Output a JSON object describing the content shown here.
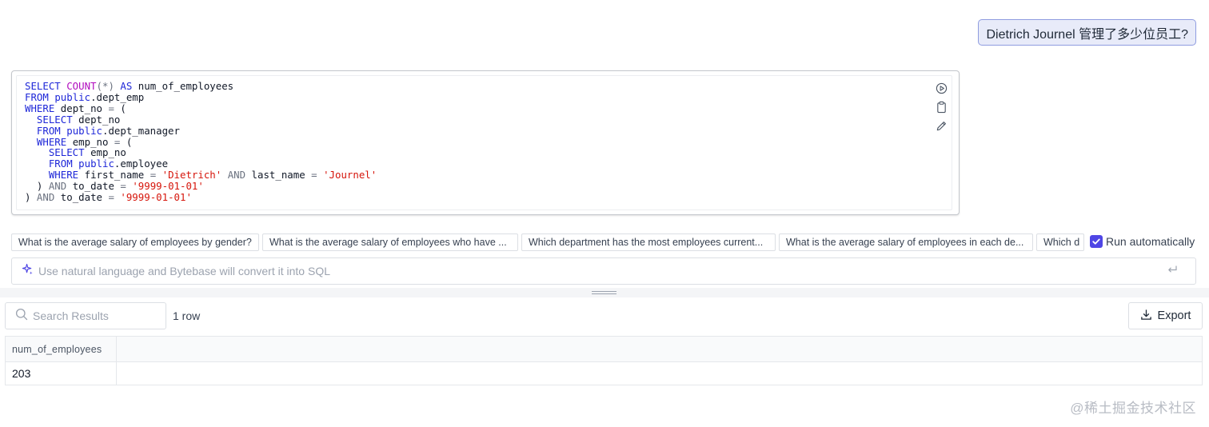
{
  "question": "Dietrich Journel 管理了多少位员工?",
  "sql": {
    "lines": [
      [
        {
          "t": "kw",
          "v": "SELECT "
        },
        {
          "t": "fn",
          "v": "COUNT"
        },
        {
          "t": "op",
          "v": "(*)"
        },
        {
          "t": "tx",
          "v": " "
        },
        {
          "t": "kw",
          "v": "AS"
        },
        {
          "t": "tx",
          "v": " num_of_employees"
        }
      ],
      [
        {
          "t": "kw",
          "v": "FROM "
        },
        {
          "t": "kw",
          "v": "public"
        },
        {
          "t": "tx",
          "v": ".dept_emp"
        }
      ],
      [
        {
          "t": "kw",
          "v": "WHERE"
        },
        {
          "t": "tx",
          "v": " dept_no "
        },
        {
          "t": "op",
          "v": "="
        },
        {
          "t": "tx",
          "v": " ("
        }
      ],
      [
        {
          "t": "tx",
          "v": "  "
        },
        {
          "t": "kw",
          "v": "SELECT"
        },
        {
          "t": "tx",
          "v": " dept_no"
        }
      ],
      [
        {
          "t": "tx",
          "v": "  "
        },
        {
          "t": "kw",
          "v": "FROM "
        },
        {
          "t": "kw",
          "v": "public"
        },
        {
          "t": "tx",
          "v": ".dept_manager"
        }
      ],
      [
        {
          "t": "tx",
          "v": "  "
        },
        {
          "t": "kw",
          "v": "WHERE"
        },
        {
          "t": "tx",
          "v": " emp_no "
        },
        {
          "t": "op",
          "v": "="
        },
        {
          "t": "tx",
          "v": " ("
        }
      ],
      [
        {
          "t": "tx",
          "v": "    "
        },
        {
          "t": "kw",
          "v": "SELECT"
        },
        {
          "t": "tx",
          "v": " emp_no"
        }
      ],
      [
        {
          "t": "tx",
          "v": "    "
        },
        {
          "t": "kw",
          "v": "FROM "
        },
        {
          "t": "kw",
          "v": "public"
        },
        {
          "t": "tx",
          "v": ".employee"
        }
      ],
      [
        {
          "t": "tx",
          "v": "    "
        },
        {
          "t": "kw",
          "v": "WHERE"
        },
        {
          "t": "tx",
          "v": " first_name "
        },
        {
          "t": "op",
          "v": "="
        },
        {
          "t": "tx",
          "v": " "
        },
        {
          "t": "str",
          "v": "'Dietrich'"
        },
        {
          "t": "tx",
          "v": " "
        },
        {
          "t": "op",
          "v": "AND"
        },
        {
          "t": "tx",
          "v": " last_name "
        },
        {
          "t": "op",
          "v": "="
        },
        {
          "t": "tx",
          "v": " "
        },
        {
          "t": "str",
          "v": "'Journel'"
        }
      ],
      [
        {
          "t": "tx",
          "v": "  ) "
        },
        {
          "t": "op",
          "v": "AND"
        },
        {
          "t": "tx",
          "v": " to_date "
        },
        {
          "t": "op",
          "v": "="
        },
        {
          "t": "tx",
          "v": " "
        },
        {
          "t": "str",
          "v": "'9999-01-01'"
        }
      ],
      [
        {
          "t": "tx",
          "v": ") "
        },
        {
          "t": "op",
          "v": "AND"
        },
        {
          "t": "tx",
          "v": " to_date "
        },
        {
          "t": "op",
          "v": "="
        },
        {
          "t": "tx",
          "v": " "
        },
        {
          "t": "str",
          "v": "'9999-01-01'"
        }
      ]
    ],
    "actions": [
      "play-icon",
      "clipboard-icon",
      "pencil-icon"
    ]
  },
  "suggestions": [
    "What is the average salary of employees by gender?",
    "What is the average salary of employees who have ...",
    "Which department has the most employees current...",
    "What is the average salary of employees in each de...",
    "Which d"
  ],
  "run_automatically": {
    "label": "Run automatically",
    "checked": true
  },
  "nl_input": {
    "placeholder": "Use natural language and Bytebase will convert it into SQL",
    "value": ""
  },
  "results": {
    "search_placeholder": "Search Results",
    "row_count": "1 row",
    "export_label": "Export",
    "columns": [
      "num_of_employees"
    ],
    "rows": [
      [
        "203"
      ]
    ]
  },
  "watermark": "@稀土掘金技术社区",
  "colors": {
    "accent": "#4f46e5",
    "keyword": "#1e27d8",
    "function": "#b10cbf",
    "string": "#d6150b",
    "bubble_bg": "#e8ebf9",
    "bubble_border": "#8f9ce0"
  }
}
